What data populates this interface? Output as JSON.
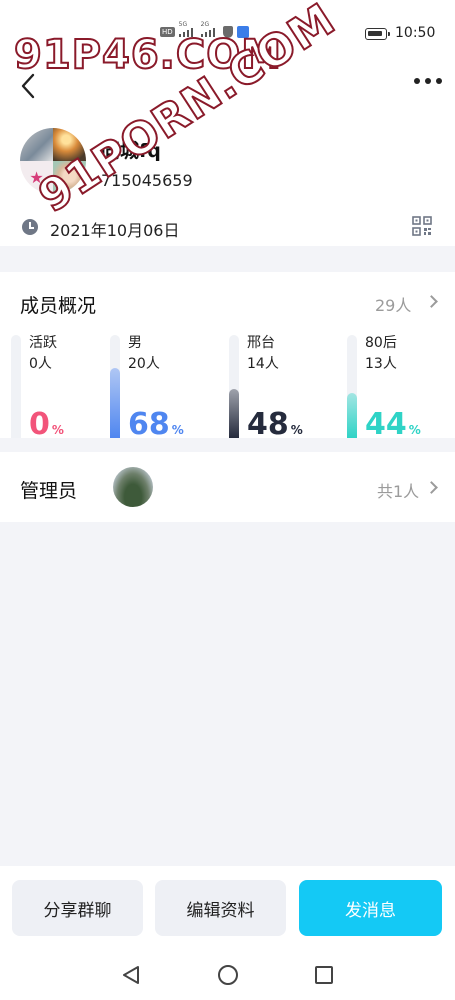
{
  "status_bar": {
    "time": "10:50",
    "indicators": [
      "HD",
      "5G",
      "2G"
    ]
  },
  "watermarks": [
    "91P46.COM",
    "91PORN.COM"
  ],
  "header": {
    "group_name": "同城fq",
    "group_id": "715045659",
    "created_date": "2021年10月06日"
  },
  "members": {
    "title": "成员概况",
    "total": "29人",
    "stats": [
      {
        "label": "活跃",
        "count": "0人",
        "percent": 0,
        "color": "#f2547a"
      },
      {
        "label": "男",
        "count": "20人",
        "percent": 68,
        "color": "#4f86f0"
      },
      {
        "label": "邢台",
        "count": "14人",
        "percent": 48,
        "color": "#252b3d"
      },
      {
        "label": "80后",
        "count": "13人",
        "percent": 44,
        "color": "#2fd3c6"
      }
    ]
  },
  "admin": {
    "title": "管理员",
    "count": "共1人"
  },
  "actions": {
    "share": "分享群聊",
    "edit": "编辑资料",
    "send": "发消息"
  }
}
